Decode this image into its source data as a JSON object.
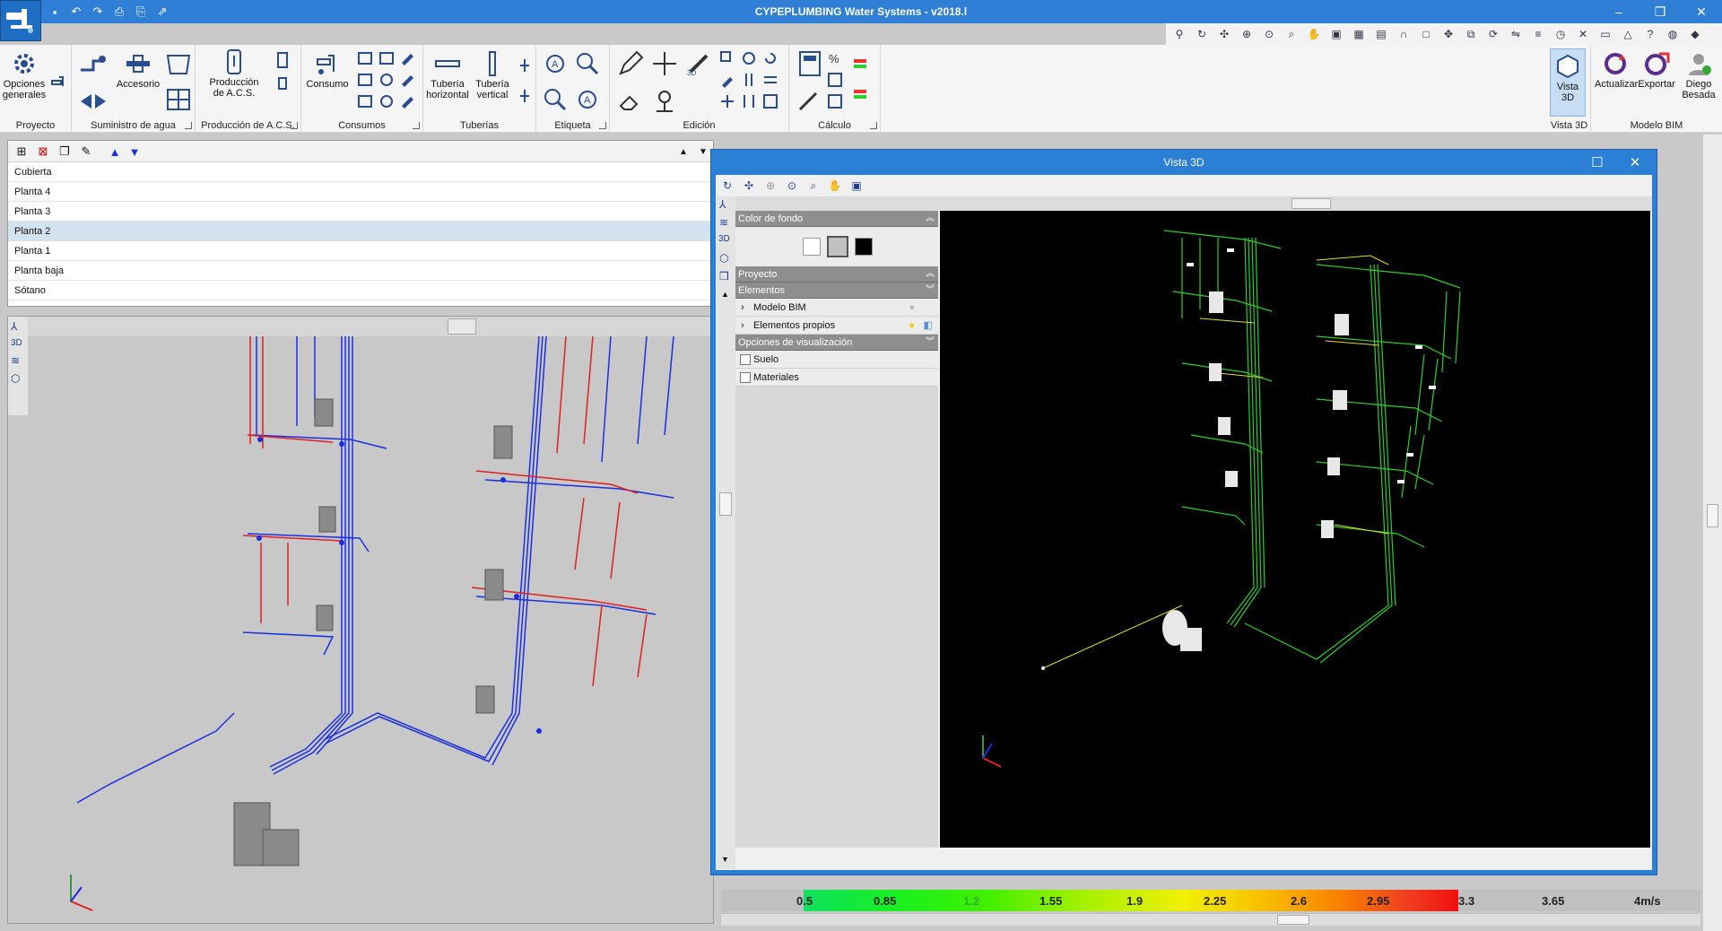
{
  "window": {
    "title": "CYPEPLUMBING Water Systems - v2018.l"
  },
  "ribbon": {
    "groups": [
      {
        "label": "Proyecto"
      },
      {
        "label": "Suministro de agua"
      },
      {
        "label": "Producción de A.C.S."
      },
      {
        "label": "Consumos"
      },
      {
        "label": "Tuberías"
      },
      {
        "label": "Etiqueta"
      },
      {
        "label": "Edición"
      },
      {
        "label": "Cálculo"
      },
      {
        "label": "Vista 3D"
      },
      {
        "label": "Modelo BIM"
      }
    ],
    "buttons": {
      "opciones": "Opciones generales",
      "accesorio": "Accesorio",
      "produccion": "Producción de A.C.S.",
      "consumo": "Consumo",
      "tuberia_h": "Tubería horizontal",
      "tuberia_v": "Tubería vertical",
      "vista3d": "Vista 3D",
      "actualizar": "Actualizar",
      "exportar": "Exportar",
      "usuario": "Diego Besada"
    }
  },
  "floors": [
    {
      "name": "Cubierta",
      "selected": false
    },
    {
      "name": "Planta 4",
      "selected": false
    },
    {
      "name": "Planta 3",
      "selected": false
    },
    {
      "name": "Planta 2",
      "selected": true
    },
    {
      "name": "Planta 1",
      "selected": false
    },
    {
      "name": "Planta baja",
      "selected": false
    },
    {
      "name": "Sótano",
      "selected": false
    }
  ],
  "vista3d": {
    "title": "Vista 3D",
    "sections": {
      "color_fondo": "Color de fondo",
      "proyecto": "Proyecto",
      "elementos": "Elementos",
      "opciones": "Opciones de visualización"
    },
    "elementos": [
      "Modelo BIM",
      "Elementos propios"
    ],
    "opciones": [
      "Suelo",
      "Materiales"
    ],
    "bg_colors": [
      "#ffffff",
      "#c0c0c0",
      "#000000"
    ]
  },
  "legend": {
    "ticks": [
      "0.5",
      "0.85",
      "1.2",
      "1.55",
      "1.9",
      "2.25",
      "2.6",
      "2.95",
      "3.3",
      "3.65"
    ],
    "unit": "4m/s"
  },
  "colors": {
    "accent": "#2f7fd6",
    "cold_pipe": "#1a2fe0",
    "hot_pipe": "#e02020"
  }
}
